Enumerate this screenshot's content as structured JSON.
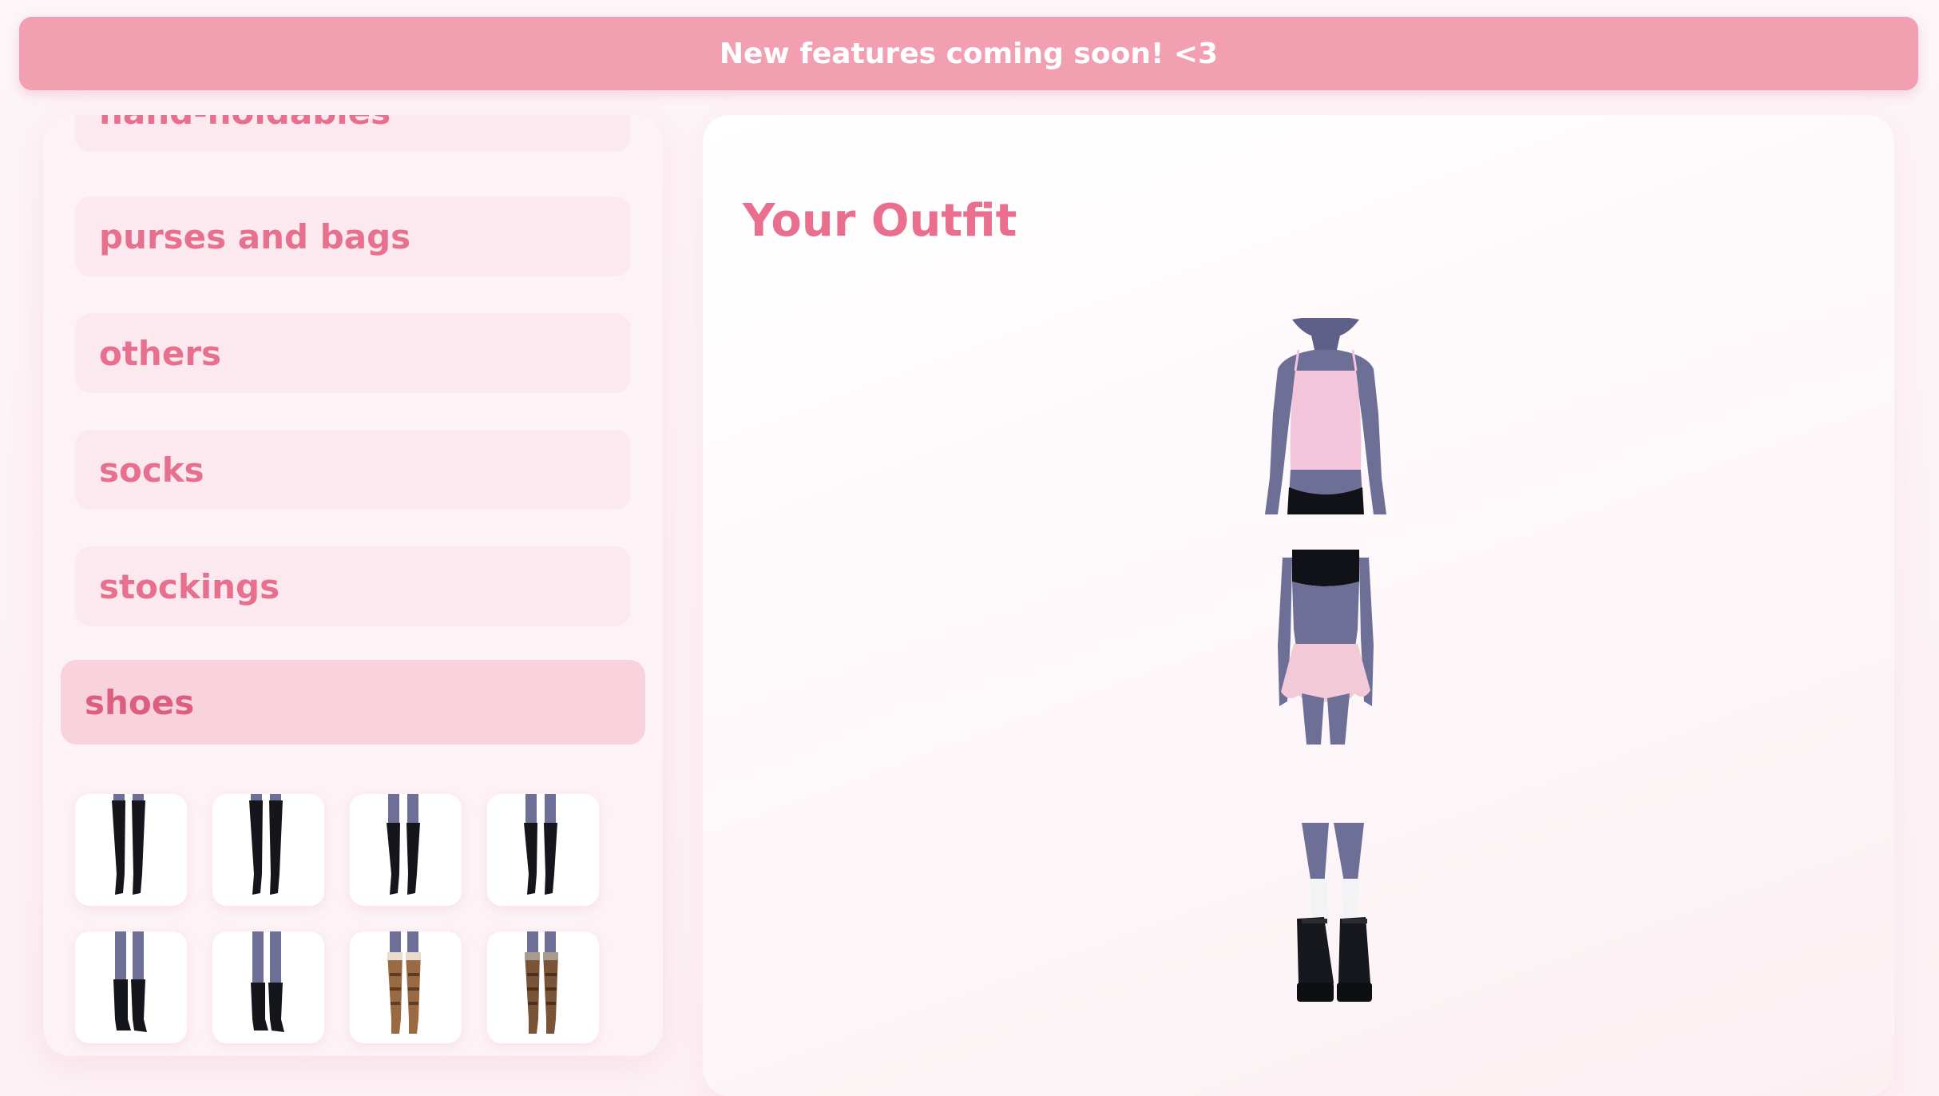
{
  "banner": {
    "text": "New features coming soon! <3",
    "color": "#f19fb1"
  },
  "categories": {
    "items": [
      {
        "label": "hand-holdables",
        "active": false
      },
      {
        "label": "purses and bags",
        "active": false
      },
      {
        "label": "others",
        "active": false
      },
      {
        "label": "socks",
        "active": false
      },
      {
        "label": "stockings",
        "active": false
      },
      {
        "label": "shoes",
        "active": true
      }
    ],
    "accent_color": "#e8708f"
  },
  "shoe_thumbnails": [
    {
      "name": "black thigh-high boots",
      "color": "#15161c"
    },
    {
      "name": "black thigh-high boots",
      "color": "#15161c"
    },
    {
      "name": "black knee boots",
      "color": "#15161c"
    },
    {
      "name": "black knee boots",
      "color": "#15161c"
    },
    {
      "name": "black ankle boots",
      "color": "#15161c"
    },
    {
      "name": "black ankle boots",
      "color": "#15161c"
    },
    {
      "name": "tan buckle boots",
      "color": "#9a6a43"
    },
    {
      "name": "brown buckle boots",
      "color": "#7a5436"
    }
  ],
  "outfit": {
    "title": "Your Outfit",
    "slots": [
      {
        "name": "top",
        "item": "pink camisole",
        "color": "#f4c6dc"
      },
      {
        "name": "bottom",
        "item": "pink ruffle mini skirt",
        "color": "#f2c9d6"
      },
      {
        "name": "shoes",
        "item": "black platform mary janes with white socks",
        "color": "#17181d"
      }
    ],
    "skin_color": "#6e6f97"
  }
}
